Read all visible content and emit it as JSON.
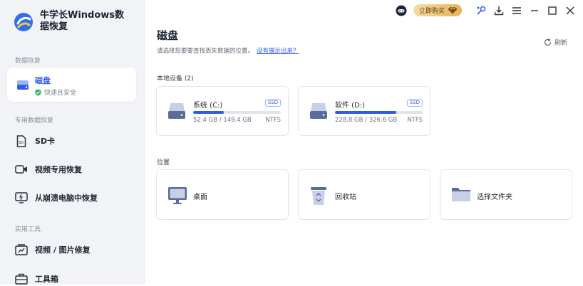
{
  "app": {
    "name": "牛学长Windows数据恢复"
  },
  "topbar": {
    "buy_label": "立即购买"
  },
  "sidebar": {
    "sections": [
      {
        "title": "数据恢复"
      },
      {
        "title": "专用数据恢复"
      },
      {
        "title": "实用工具"
      }
    ],
    "active_item": {
      "label": "磁盘",
      "sub": "快速且安全"
    },
    "items": [
      {
        "label": "SD卡"
      },
      {
        "label": "视频专用恢复"
      },
      {
        "label": "从崩溃电脑中恢复"
      },
      {
        "label": "视频 / 图片修复"
      },
      {
        "label": "工具箱"
      }
    ]
  },
  "main": {
    "title": "磁盘",
    "description": "请选择您要要查找丢失数据的位置。",
    "help_link": "没有展示出来？",
    "refresh_label": "刷新",
    "local_devices_title": "本地设备 (2)",
    "drives": [
      {
        "name": "系统 (C:)",
        "badge": "SSD",
        "size": "52.4 GB / 149.4 GB",
        "fs": "NTFS",
        "used_fraction": 0.35
      },
      {
        "name": "软件 (D:)",
        "badge": "SSD",
        "size": "228.8 GB / 326.6 GB",
        "fs": "NTFS",
        "used_fraction": 0.7
      }
    ],
    "locations_title": "位置",
    "locations": [
      {
        "name": "桌面"
      },
      {
        "name": "回收站"
      },
      {
        "name": "选择文件夹"
      }
    ]
  }
}
